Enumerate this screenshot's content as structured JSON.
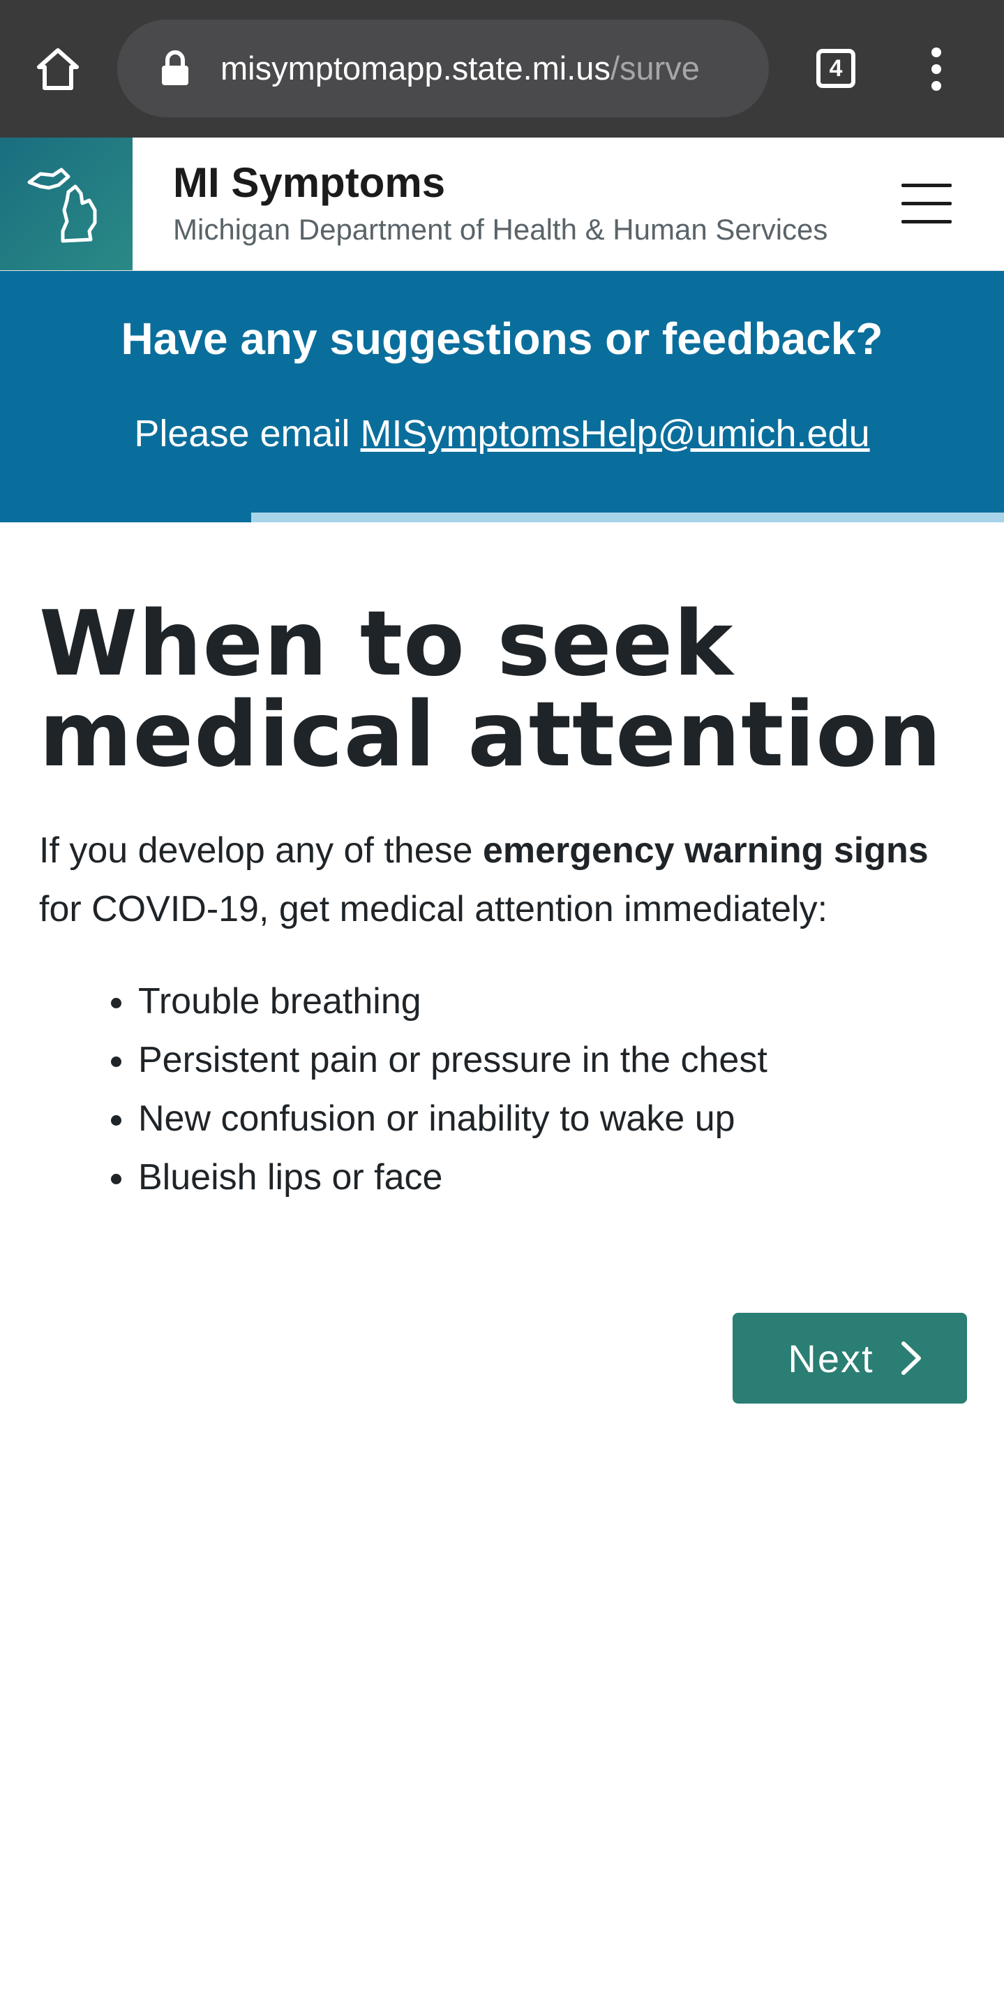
{
  "browser": {
    "url_host": "misymptomapp.state.mi.us",
    "url_path": "/surve",
    "tab_count": "4"
  },
  "header": {
    "title": "MI Symptoms",
    "subtitle": "Michigan Department of Health & Human Services"
  },
  "banner": {
    "title": "Have any suggestions or feedback?",
    "text_prefix": "Please email ",
    "email": "MISymptomsHelp@umich.edu",
    "progress": 0.75
  },
  "content": {
    "heading_line1": "When to seek",
    "heading_line2": "medical attention",
    "intro_prefix": "If you develop any of these ",
    "intro_bold": "emergency warning signs",
    "intro_suffix": " for COVID-19, get medical attention immediately:",
    "signs": [
      "Trouble breathing",
      "Persistent pain or pressure in the chest",
      "New confusion or inability to wake up",
      "Blueish lips or face"
    ],
    "next_label": "Next"
  },
  "colors": {
    "chrome": "#3a3a3b",
    "banner": "#0a6e9c",
    "progress": "#a8d4ea",
    "button": "#2a7e73"
  }
}
